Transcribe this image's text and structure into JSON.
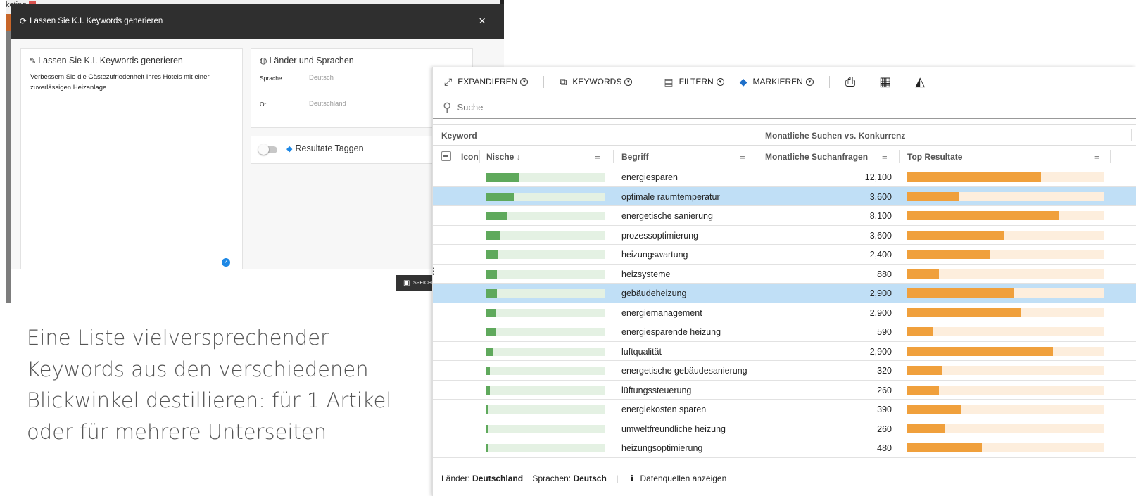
{
  "background_window": {
    "top_label": "keting"
  },
  "modal": {
    "title": "Lassen Sie K.I. Keywords generieren",
    "close": "×",
    "left_card": {
      "title": "Lassen Sie K.I. Keywords generieren",
      "text": "Verbessern Sie die Gästezufriedenheit Ihres Hotels mit einer zuverlässigen Heizanlage"
    },
    "right_card": {
      "title": "Länder und Sprachen",
      "fields": [
        {
          "label": "Sprache",
          "value": "Deutsch"
        },
        {
          "label": "Ort",
          "value": "Deutschland"
        }
      ]
    },
    "tag_card": {
      "label": "Resultate Taggen"
    },
    "save_label": "SPEICHE"
  },
  "caption": "Eine Liste vielversprechender Keywords aus den verschiedenen Blickwinkel destillieren: für 1 Artikel oder für mehrere Unterseiten",
  "toolbar": {
    "expand": "EXPANDIEREN",
    "keywords": "KEYWORDS",
    "filter": "FILTERN",
    "mark": "MARKIEREN"
  },
  "search": {
    "placeholder": "Suche"
  },
  "groups": {
    "keyword": "Keyword",
    "monthly": "Monatliche Suchen vs. Konkurrenz"
  },
  "columns": {
    "icon": "Icon",
    "niche": "Nische",
    "term": "Begriff",
    "monthly_searches": "Monatliche Suchanfragen",
    "top_results": "Top Resultate"
  },
  "rows": [
    {
      "term": "energiesparen",
      "count": "12,100",
      "niche": 0.28,
      "top": 0.68,
      "selected": false
    },
    {
      "term": "optimale raumtemperatur",
      "count": "3,600",
      "niche": 0.23,
      "top": 0.26,
      "selected": true
    },
    {
      "term": "energetische sanierung",
      "count": "8,100",
      "niche": 0.17,
      "top": 0.77,
      "selected": false
    },
    {
      "term": "prozessoptimierung",
      "count": "3,600",
      "niche": 0.12,
      "top": 0.49,
      "selected": false
    },
    {
      "term": "heizungswartung",
      "count": "2,400",
      "niche": 0.1,
      "top": 0.42,
      "selected": false
    },
    {
      "term": "heizsysteme",
      "count": "880",
      "niche": 0.09,
      "top": 0.16,
      "selected": false
    },
    {
      "term": "gebäudeheizung",
      "count": "2,900",
      "niche": 0.09,
      "top": 0.54,
      "selected": true
    },
    {
      "term": "energiemanagement",
      "count": "2,900",
      "niche": 0.08,
      "top": 0.58,
      "selected": false
    },
    {
      "term": "energiesparende heizung",
      "count": "590",
      "niche": 0.08,
      "top": 0.13,
      "selected": false
    },
    {
      "term": "luftqualität",
      "count": "2,900",
      "niche": 0.06,
      "top": 0.74,
      "selected": false
    },
    {
      "term": "energetische gebäudesanierung",
      "count": "320",
      "niche": 0.03,
      "top": 0.18,
      "selected": false
    },
    {
      "term": "lüftungssteuerung",
      "count": "260",
      "niche": 0.03,
      "top": 0.16,
      "selected": false
    },
    {
      "term": "energiekosten sparen",
      "count": "390",
      "niche": 0.02,
      "top": 0.27,
      "selected": false
    },
    {
      "term": "umweltfreundliche heizung",
      "count": "260",
      "niche": 0.02,
      "top": 0.19,
      "selected": false
    },
    {
      "term": "heizungsoptimierung",
      "count": "480",
      "niche": 0.02,
      "top": 0.38,
      "selected": false
    }
  ],
  "footer": {
    "countries_label": "Länder:",
    "countries_value": "Deutschland",
    "languages_label": "Sprachen:",
    "languages_value": "Deutsch",
    "sep": "|",
    "sources": "Datenquellen anzeigen"
  },
  "colors": {
    "niche_fill": "#5fa95c",
    "niche_track": "#e4f1e3",
    "top_fill": "#f0a03c",
    "top_track": "#fdeedd",
    "selected_row": "#c0dff6"
  }
}
